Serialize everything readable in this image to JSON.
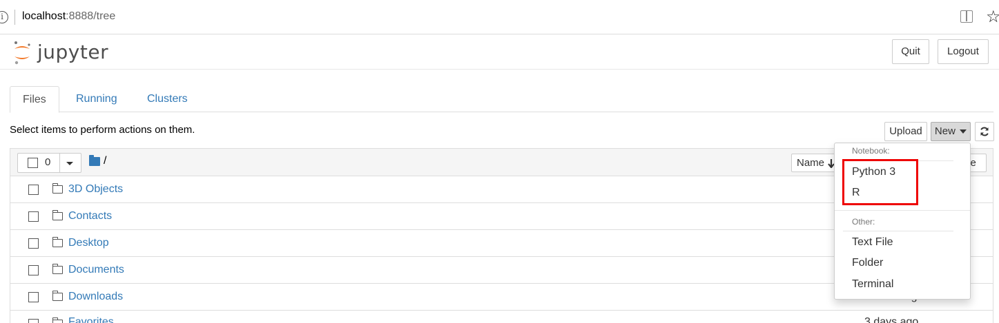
{
  "browser": {
    "url_host": "localhost",
    "url_rest": ":8888/tree",
    "info_glyph": "i",
    "star_glyph": "☆"
  },
  "header": {
    "logo_text": "jupyter",
    "quit_label": "Quit",
    "logout_label": "Logout"
  },
  "tabs": [
    {
      "label": "Files",
      "active": true
    },
    {
      "label": "Running",
      "active": false
    },
    {
      "label": "Clusters",
      "active": false
    }
  ],
  "toolbar": {
    "instruction": "Select items to perform actions on them.",
    "upload_label": "Upload",
    "new_label": "New",
    "refresh_icon": "refresh-icon"
  },
  "listing": {
    "selected_count": "0",
    "breadcrumb": "/",
    "sort_name_label": "Name",
    "sort_size_label": "ze",
    "rows": [
      {
        "name": "3D Objects",
        "date": ""
      },
      {
        "name": "Contacts",
        "date": ""
      },
      {
        "name": "Desktop",
        "date": ""
      },
      {
        "name": "Documents",
        "date": ""
      },
      {
        "name": "Downloads",
        "date": "an hour ago"
      },
      {
        "name": "Favorites",
        "date": "3 days ago"
      }
    ]
  },
  "new_menu": {
    "notebook_header": "Notebook:",
    "notebook_items": [
      "Python 3",
      "R"
    ],
    "other_header": "Other:",
    "other_items": [
      "Text File",
      "Folder",
      "Terminal"
    ]
  },
  "colors": {
    "link": "#337ab7",
    "highlight": "#ee0000",
    "logo_orange": "#f37726"
  }
}
